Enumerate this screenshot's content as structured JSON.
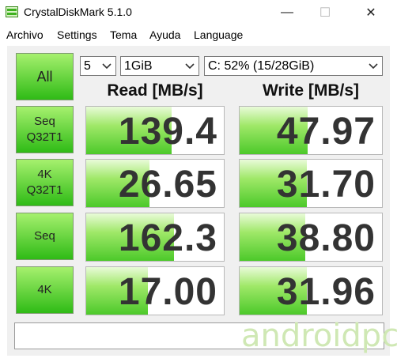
{
  "window": {
    "title": "CrystalDiskMark 5.1.0",
    "minimize_glyph": "—",
    "maximize_glyph": "☐",
    "close_glyph": "✕"
  },
  "menu": [
    {
      "label": "Archivo"
    },
    {
      "label": "Settings"
    },
    {
      "label": "Tema"
    },
    {
      "label": "Ayuda"
    },
    {
      "label": "Language"
    }
  ],
  "controls": {
    "all_label": "All",
    "count_value": "5",
    "size_value": "1GiB",
    "drive_value": "C: 52% (15/28GiB)"
  },
  "headers": {
    "read": "Read [MB/s]",
    "write": "Write [MB/s]"
  },
  "rows": [
    {
      "label_line1": "Seq",
      "label_line2": "Q32T1",
      "read": "139.4",
      "write": "47.97",
      "read_fill": 0.62,
      "write_fill": 0.48
    },
    {
      "label_line1": "4K",
      "label_line2": "Q32T1",
      "read": "26.65",
      "write": "31.70",
      "read_fill": 0.46,
      "write_fill": 0.47
    },
    {
      "label_line1": "Seq",
      "label_line2": "",
      "read": "162.3",
      "write": "38.80",
      "read_fill": 0.64,
      "write_fill": 0.46
    },
    {
      "label_line1": "4K",
      "label_line2": "",
      "read": "17.00",
      "write": "31.96",
      "read_fill": 0.45,
      "write_fill": 0.47
    }
  ],
  "status_text": "",
  "watermark": "androidpc",
  "colors": {
    "button_green_top": "#a6f06e",
    "button_green_bottom": "#2fbb16",
    "bar_green": "#4cc92a"
  }
}
